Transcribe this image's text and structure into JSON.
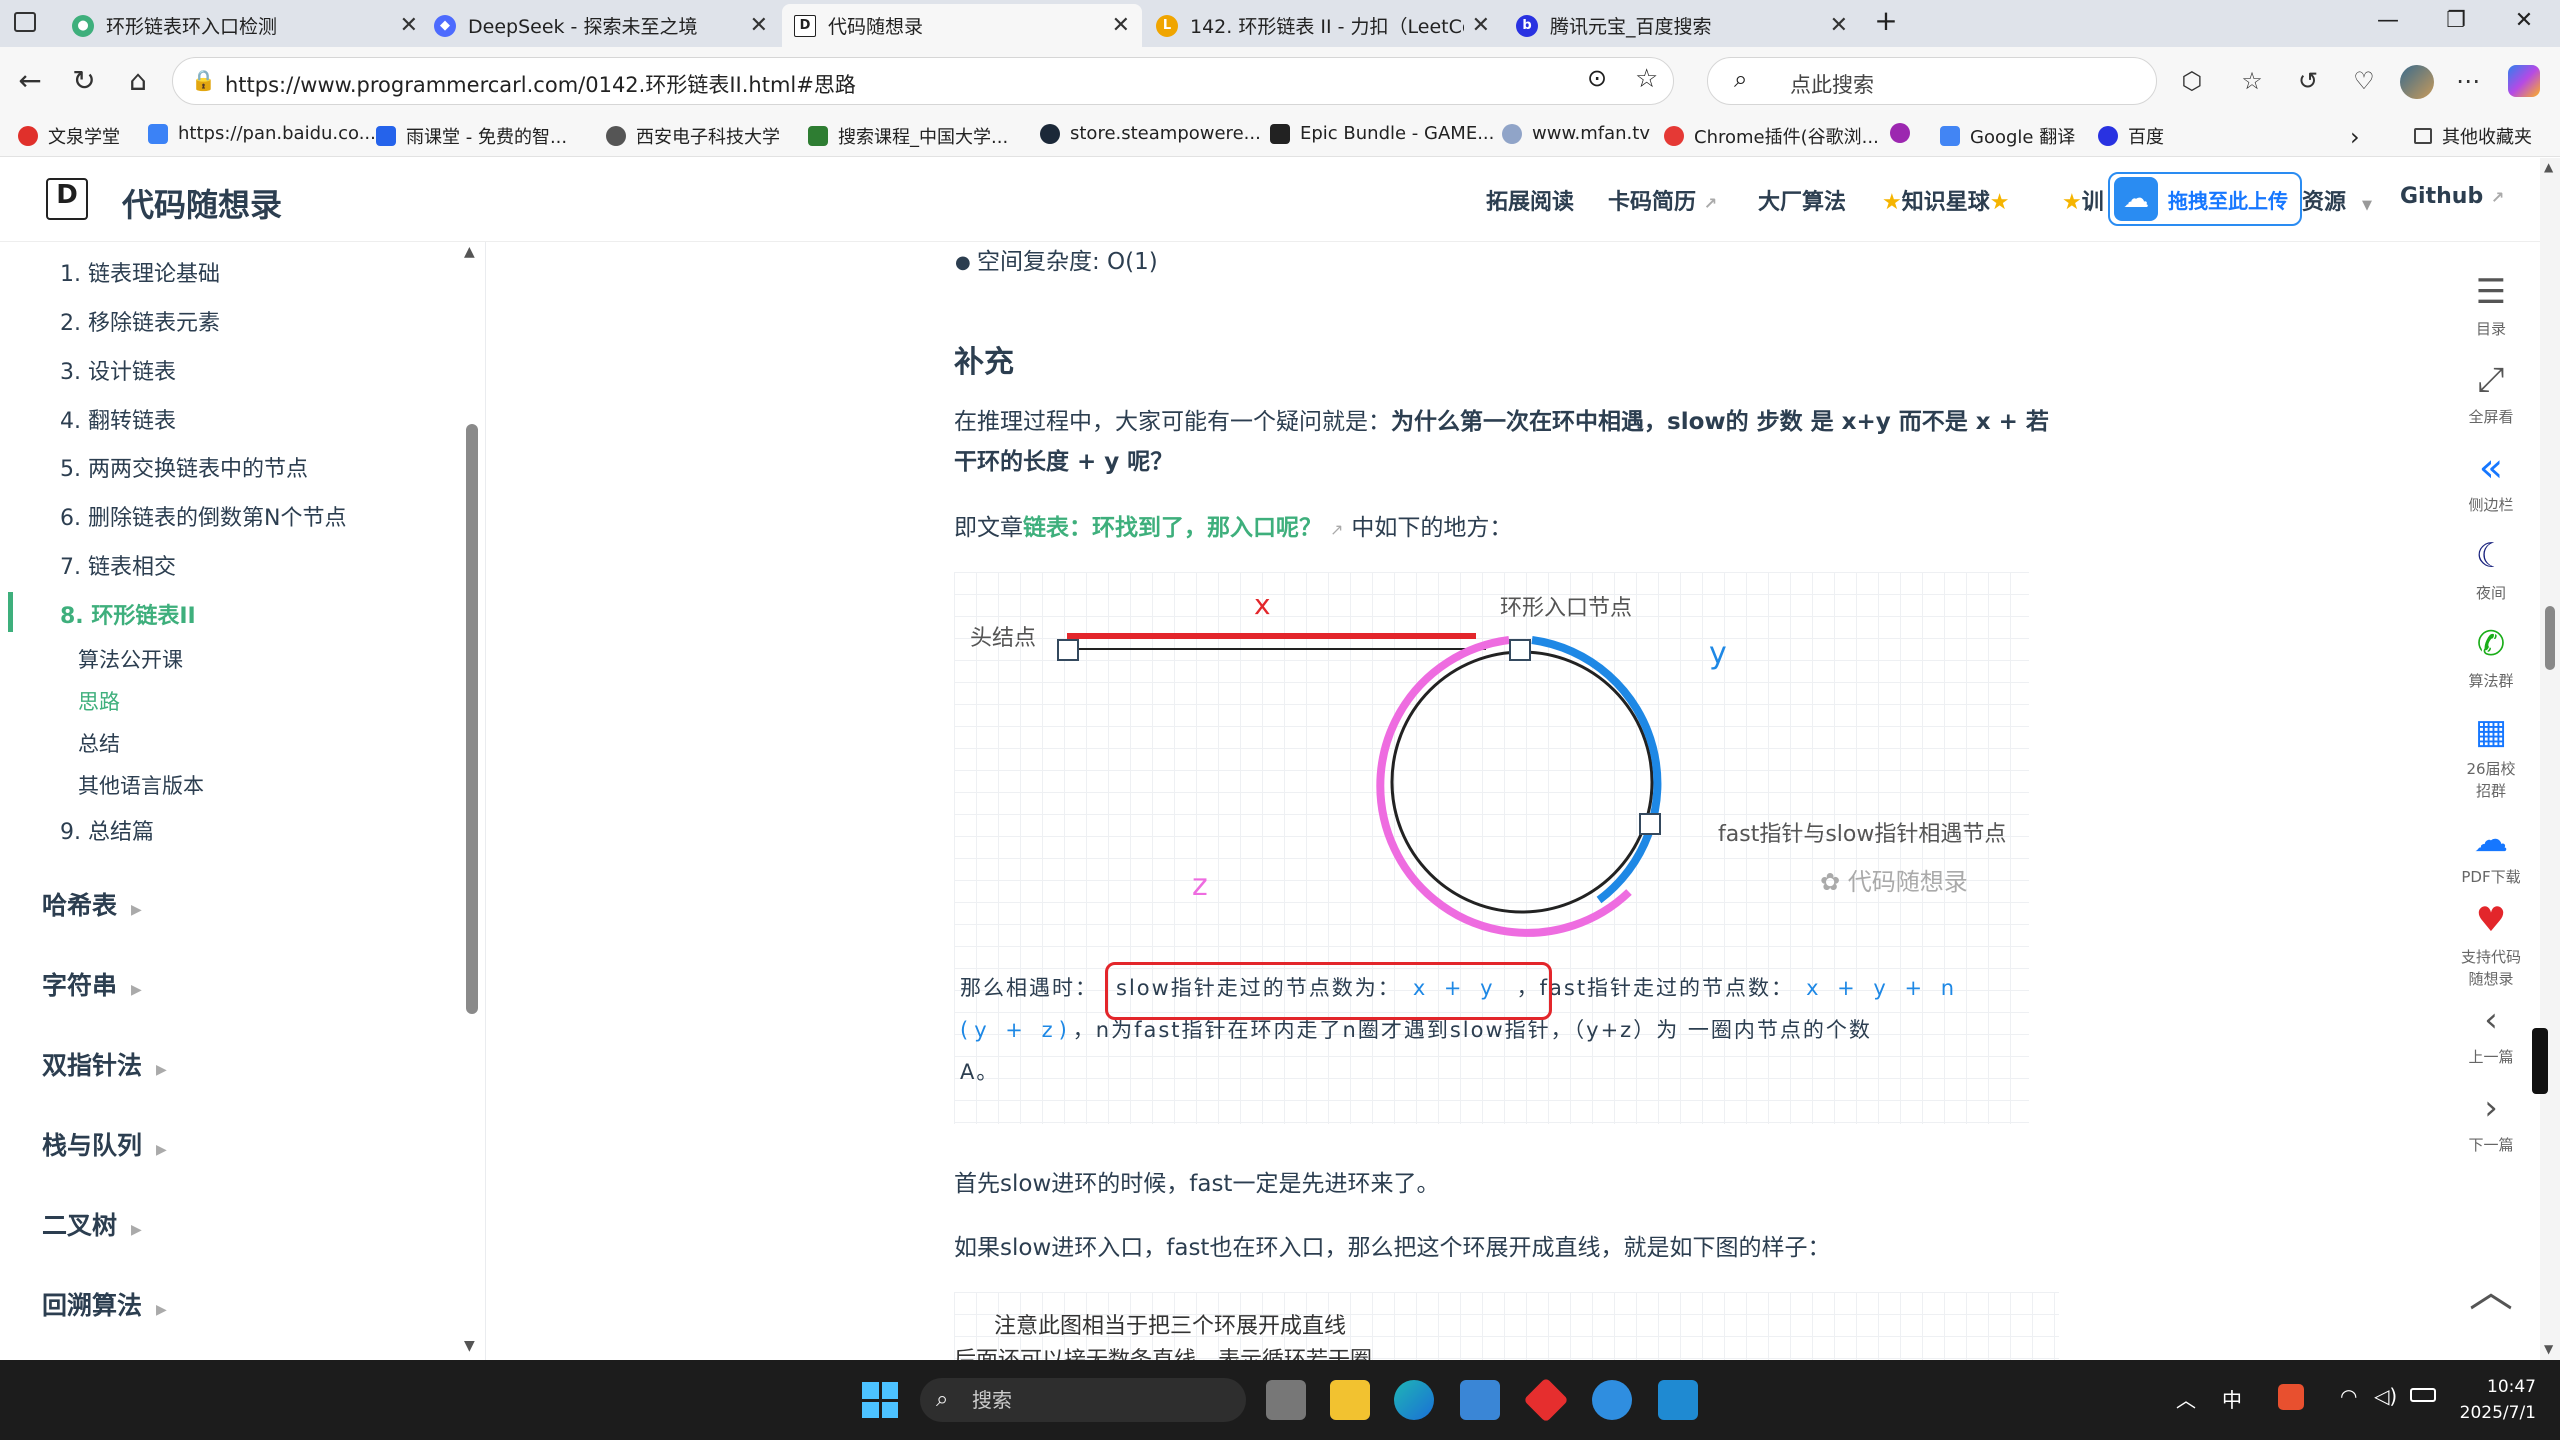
{
  "browser": {
    "tabs": [
      {
        "title": "环形链表环入口检测",
        "active": false
      },
      {
        "title": "DeepSeek - 探索未至之境",
        "active": false
      },
      {
        "title": "代码随想录",
        "active": true
      },
      {
        "title": "142. 环形链表 II - 力扣（LeetCode）",
        "active": false
      },
      {
        "title": "腾讯元宝_百度搜索",
        "active": false
      }
    ],
    "url": "https://www.programmercarl.com/0142.环形链表II.html#思路",
    "search_placeholder": "点此搜索",
    "bookmarks": [
      "文泉学堂",
      "https://pan.baidu.co...",
      "雨课堂 - 免费的智...",
      "西安电子科技大学",
      "搜索课程_中国大学...",
      "store.steampowere...",
      "Epic Bundle - GAME...",
      "www.mfan.tv",
      "Chrome插件(谷歌浏...",
      "Google 翻译",
      "百度"
    ],
    "other_bookmarks": "其他收藏夹"
  },
  "site": {
    "title": "代码随想录",
    "nav": [
      "拓展阅读",
      "卡码简历",
      "大厂算法",
      "知识星球",
      "训",
      "资源",
      "Github"
    ],
    "upload_label": "拖拽至此上传"
  },
  "sidebar": {
    "items": [
      {
        "label": "1. 链表理论基础"
      },
      {
        "label": "2. 移除链表元素"
      },
      {
        "label": "3. 设计链表"
      },
      {
        "label": "4. 翻转链表"
      },
      {
        "label": "5. 两两交换链表中的节点"
      },
      {
        "label": "6. 删除链表的倒数第N个节点"
      },
      {
        "label": "7. 链表相交"
      },
      {
        "label": "8. 环形链表II"
      },
      {
        "label": "9. 总结篇"
      }
    ],
    "subitems": [
      "算法公开课",
      "思路",
      "总结",
      "其他语言版本"
    ],
    "categories": [
      "哈希表",
      "字符串",
      "双指针法",
      "栈与队列",
      "二叉树",
      "回溯算法"
    ]
  },
  "content": {
    "bullet": "空间复杂度: O(1)",
    "heading": "补充",
    "para1_pre": "在推理过程中，大家可能有一个疑问就是：",
    "para1_bold_a": "为什么第一次在环中相遇，slow的 步数 是 x+y 而不是 x + 若",
    "para1_bold_b": "干环的长度 + y 呢？",
    "para2_pre": "即文章",
    "para2_link": "链表：环找到了，那入口呢？",
    "para2_post": "中如下的地方：",
    "figure": {
      "head_node": "头结点",
      "entry_node": "环形入口节点",
      "meet_node": "fast指针与slow指针相遇节点",
      "x": "x",
      "y": "y",
      "z": "z",
      "watermark": "代码随想录",
      "caption_a": "那么相遇时：",
      "caption_box": "slow指针走过的节点数为：",
      "caption_box_math": "x + y",
      "caption_b": "，fast指针走过的节点数：",
      "caption_math2": "x + y + n",
      "caption_math3": "(y + z)",
      "caption_c": "，n为fast指针在环内走了n圈才遇到slow指针，（y+z）为 一圈内节点的个数",
      "caption_d": "A。"
    },
    "para3": "首先slow进环的时候，fast一定是先进环来了。",
    "para4": "如果slow进环入口，fast也在环入口，那么把这个环展开成直线，就是如下图的样子：",
    "fig2_line1": "注意此图相当于把三个环展开成直线",
    "fig2_line2": "后面还可以接无数条直线，表示循环若干圈"
  },
  "right_toolbar": [
    "目录",
    "全屏看",
    "侧边栏",
    "夜间",
    "算法群",
    "26届校招群",
    "PDF下载",
    "支持代码随想录",
    "上一篇",
    "下一篇"
  ],
  "taskbar": {
    "search": "搜索",
    "ime": "中",
    "time": "10:47",
    "date": "2025/7/1"
  },
  "colors": {
    "accent": "#3eaf7c",
    "red": "#e3262b",
    "pink": "#ee6ce0",
    "blue": "#1e88e5"
  }
}
